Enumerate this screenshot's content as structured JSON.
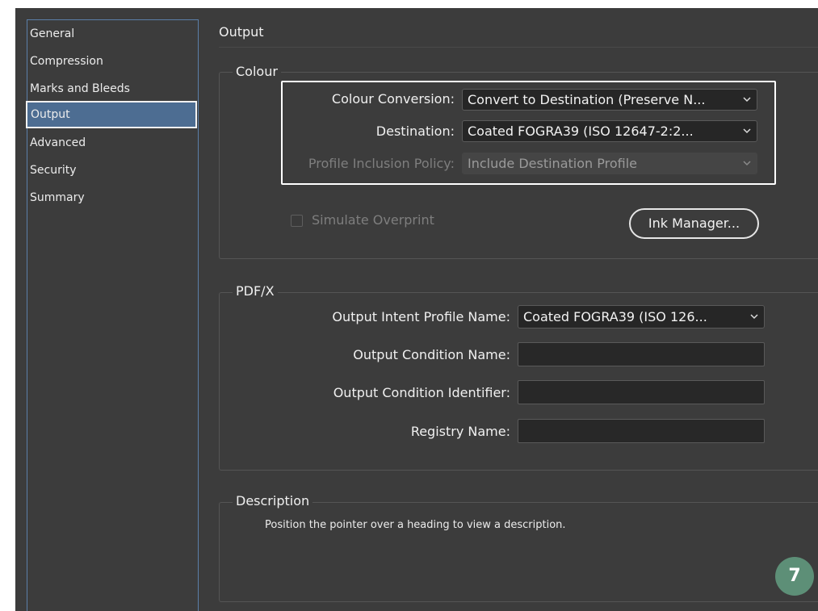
{
  "sidebar": {
    "items": [
      {
        "label": "General"
      },
      {
        "label": "Compression"
      },
      {
        "label": "Marks and Bleeds"
      },
      {
        "label": "Output",
        "selected": true
      },
      {
        "label": "Advanced"
      },
      {
        "label": "Security"
      },
      {
        "label": "Summary"
      }
    ]
  },
  "page": {
    "title": "Output"
  },
  "colour": {
    "group_title": "Colour",
    "conversion_label": "Colour Conversion:",
    "conversion_value": "Convert to Destination (Preserve N...",
    "destination_label": "Destination:",
    "destination_value": "Coated FOGRA39 (ISO 12647-2:2...",
    "profile_policy_label": "Profile Inclusion Policy:",
    "profile_policy_value": "Include Destination Profile",
    "simulate_overprint_label": "Simulate Overprint",
    "simulate_overprint_checked": false,
    "ink_manager_label": "Ink Manager..."
  },
  "pdfx": {
    "group_title": "PDF/X",
    "intent_profile_label": "Output Intent Profile Name:",
    "intent_profile_value": "Coated FOGRA39 (ISO 126...",
    "condition_name_label": "Output Condition Name:",
    "condition_name_value": "",
    "condition_identifier_label": "Output Condition Identifier:",
    "condition_identifier_value": "",
    "registry_name_label": "Registry Name:",
    "registry_name_value": ""
  },
  "description": {
    "group_title": "Description",
    "text": "Position the pointer over a heading to view a description."
  },
  "badge": {
    "number": "7"
  },
  "colors": {
    "dialog_bg": "#3c3c3c",
    "selection": "#4d6d92",
    "badge": "#5d8f77"
  }
}
